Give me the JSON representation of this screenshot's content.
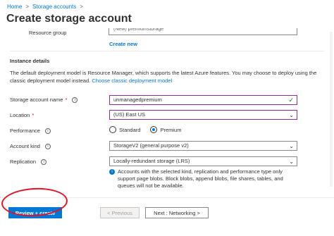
{
  "breadcrumb": {
    "home": "Home",
    "separator": ">",
    "storage": "Storage accounts",
    "trailing": ">"
  },
  "page_title": "Create storage account",
  "resource_group": {
    "label": "Resource group",
    "value": "(New) premiumstorage",
    "create_new": "Create new"
  },
  "instance": {
    "title": "Instance details",
    "description": "The default deployment model is Resource Manager, which supports the latest Azure features. You may choose to deploy using the classic deployment model instead.",
    "classic_link": "Choose classic deployment model"
  },
  "fields": {
    "name_label": "Storage account name",
    "name_value": "unmanagedpremium",
    "location_label": "Location",
    "location_value": "(US) East US",
    "performance_label": "Performance",
    "performance_standard": "Standard",
    "performance_premium": "Premium",
    "account_kind_label": "Account kind",
    "account_kind_value": "StorageV2 (general purpose v2)",
    "replication_label": "Replication",
    "replication_value": "Locally-redundant storage (LRS)",
    "required_mark": "*"
  },
  "note": "Accounts with the selected kind, replication and performance type only support page blobs. Block blobs, append blobs, file shares, tables, and queues will not be available.",
  "footer": {
    "review_create": "Review + create",
    "previous": "< Previous",
    "next": "Next : Networking >"
  },
  "colors": {
    "accent": "#0078d4",
    "highlight_ring": "#e81123",
    "valid": "#107c10"
  }
}
